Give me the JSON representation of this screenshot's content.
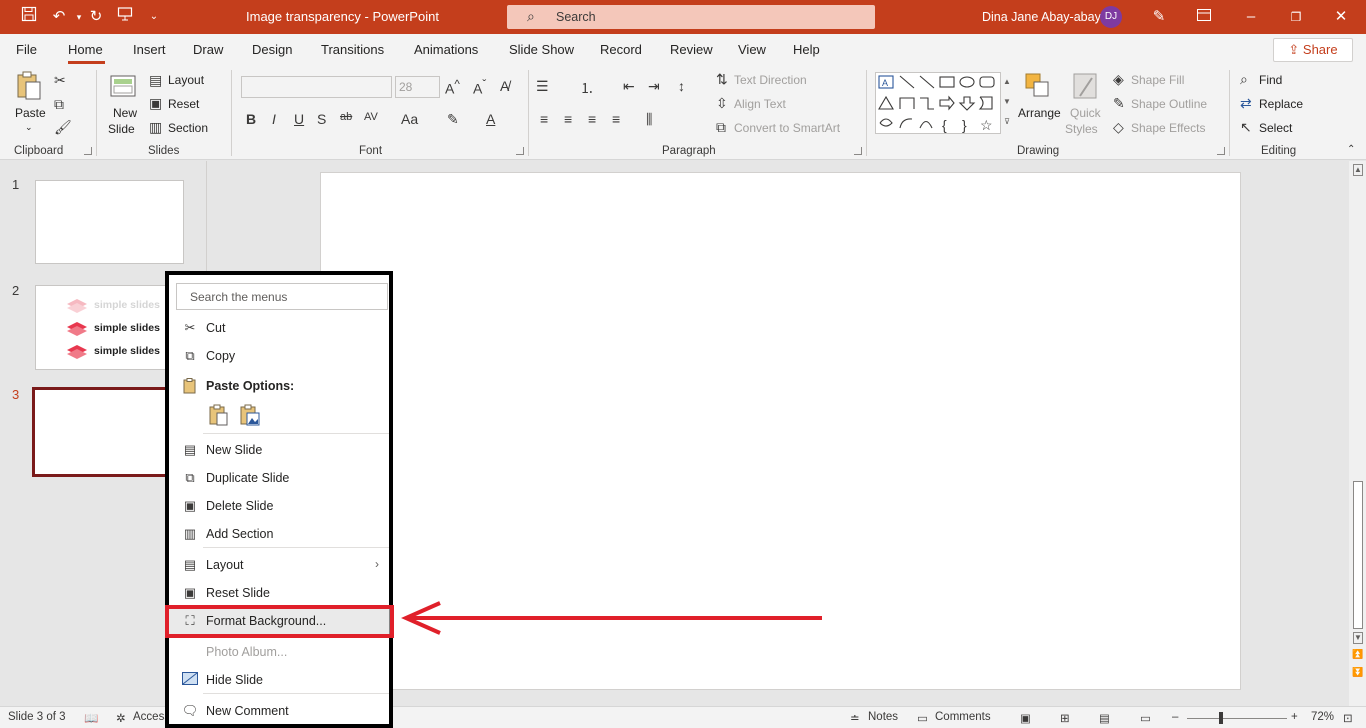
{
  "titlebar": {
    "doc_title": "Image transparency  -  PowerPoint",
    "search_placeholder": "Search",
    "user_name": "Dina Jane Abay-abay",
    "avatar_initials": "DJ",
    "accent_color": "#c43e1c"
  },
  "tabs": [
    "File",
    "Home",
    "Insert",
    "Draw",
    "Design",
    "Transitions",
    "Animations",
    "Slide Show",
    "Record",
    "Review",
    "View",
    "Help"
  ],
  "active_tab": "Home",
  "share_label": "Share",
  "ribbon": {
    "clipboard": {
      "paste": "Paste",
      "label": "Clipboard"
    },
    "slides": {
      "new_slide_1": "New",
      "new_slide_2": "Slide",
      "layout": "Layout",
      "reset": "Reset",
      "section": "Section",
      "label": "Slides"
    },
    "font": {
      "size": "28",
      "label": "Font"
    },
    "paragraph": {
      "text_direction": "Text Direction",
      "align_text": "Align Text",
      "convert_smartart": "Convert to SmartArt",
      "label": "Paragraph"
    },
    "drawing": {
      "arrange": "Arrange",
      "quick_1": "Quick",
      "quick_2": "Styles",
      "shape_fill": "Shape Fill",
      "shape_outline": "Shape Outline",
      "shape_effects": "Shape Effects",
      "label": "Drawing"
    },
    "editing": {
      "find": "Find",
      "replace": "Replace",
      "select": "Select",
      "label": "Editing"
    }
  },
  "thumbnails": [
    {
      "num": "1"
    },
    {
      "num": "2",
      "logo_rows": [
        "simple slides",
        "simple slides",
        "simple slides"
      ]
    },
    {
      "num": "3"
    }
  ],
  "context_menu": {
    "search_placeholder": "Search the menus",
    "items": {
      "cut": "Cut",
      "copy": "Copy",
      "paste_options": "Paste Options:",
      "new_slide": "New Slide",
      "duplicate_slide": "Duplicate Slide",
      "delete_slide": "Delete Slide",
      "add_section": "Add Section",
      "layout": "Layout",
      "reset_slide": "Reset Slide",
      "format_background": "Format Background...",
      "photo_album": "Photo Album...",
      "hide_slide": "Hide Slide",
      "new_comment": "New Comment"
    },
    "highlight_color": "#e0202a"
  },
  "statusbar": {
    "slide_info": "Slide 3 of 3",
    "accessibility": "Access",
    "notes": "Notes",
    "comments": "Comments",
    "zoom": "72%"
  }
}
